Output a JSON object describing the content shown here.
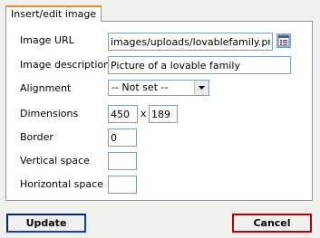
{
  "tab": {
    "label": "Insert/edit image"
  },
  "form": {
    "image_url": {
      "label": "Image URL",
      "value": "images/uploads/lovablefamily.png"
    },
    "image_description": {
      "label": "Image description",
      "value": "Picture of a lovable family"
    },
    "alignment": {
      "label": "Alignment",
      "selected": "-- Not set --"
    },
    "dimensions": {
      "label": "Dimensions",
      "width": "450",
      "separator": "x",
      "height": "189"
    },
    "border": {
      "label": "Border",
      "value": "0"
    },
    "vertical_space": {
      "label": "Vertical space",
      "value": ""
    },
    "horizontal_space": {
      "label": "Horizontal space",
      "value": ""
    }
  },
  "buttons": {
    "update": "Update",
    "cancel": "Cancel"
  },
  "icons": {
    "browse": "browse-icon",
    "dropdown": "chevron-down-icon"
  },
  "colors": {
    "tab_accent": "#e68b2c",
    "update_border": "#0a246a",
    "cancel_border": "#b40000",
    "input_border": "#7f9db9"
  }
}
